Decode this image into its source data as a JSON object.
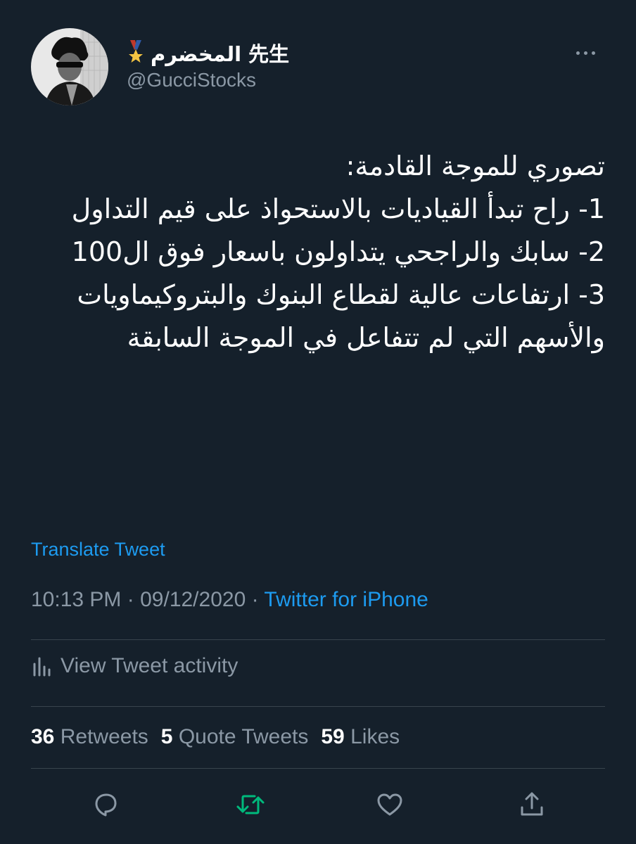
{
  "user": {
    "display_name": "المخضرم 先生",
    "handle": "@GucciStocks"
  },
  "tweet": {
    "lines": [
      "تصوري للموجة القادمة:",
      "1- راح تبدأ القياديات بالاستحواذ على قيم التداول",
      "2- سابك والراجحي يتداولون باسعار فوق ال100",
      "3- ارتفاعات عالية لقطاع البنوك والبتروكيماويات والأسهم التي لم تتفاعل في الموجة السابقة"
    ]
  },
  "translate_label": "Translate Tweet",
  "meta": {
    "time": "10:13 PM",
    "separator": "·",
    "date": "09/12/2020",
    "source": "Twitter for iPhone"
  },
  "activity_label": "View Tweet activity",
  "stats": {
    "retweets_count": "36",
    "retweets_label": "Retweets",
    "quotes_count": "5",
    "quotes_label": "Quote Tweets",
    "likes_count": "59",
    "likes_label": "Likes"
  },
  "colors": {
    "background": "#15202b",
    "accent": "#1d9bf0",
    "secondary_text": "#8b98a5",
    "retweet_green": "#00ba7c"
  },
  "icons": [
    "more-icon",
    "medal-icon",
    "analytics-icon",
    "reply-icon",
    "retweet-icon",
    "like-icon",
    "share-icon"
  ]
}
